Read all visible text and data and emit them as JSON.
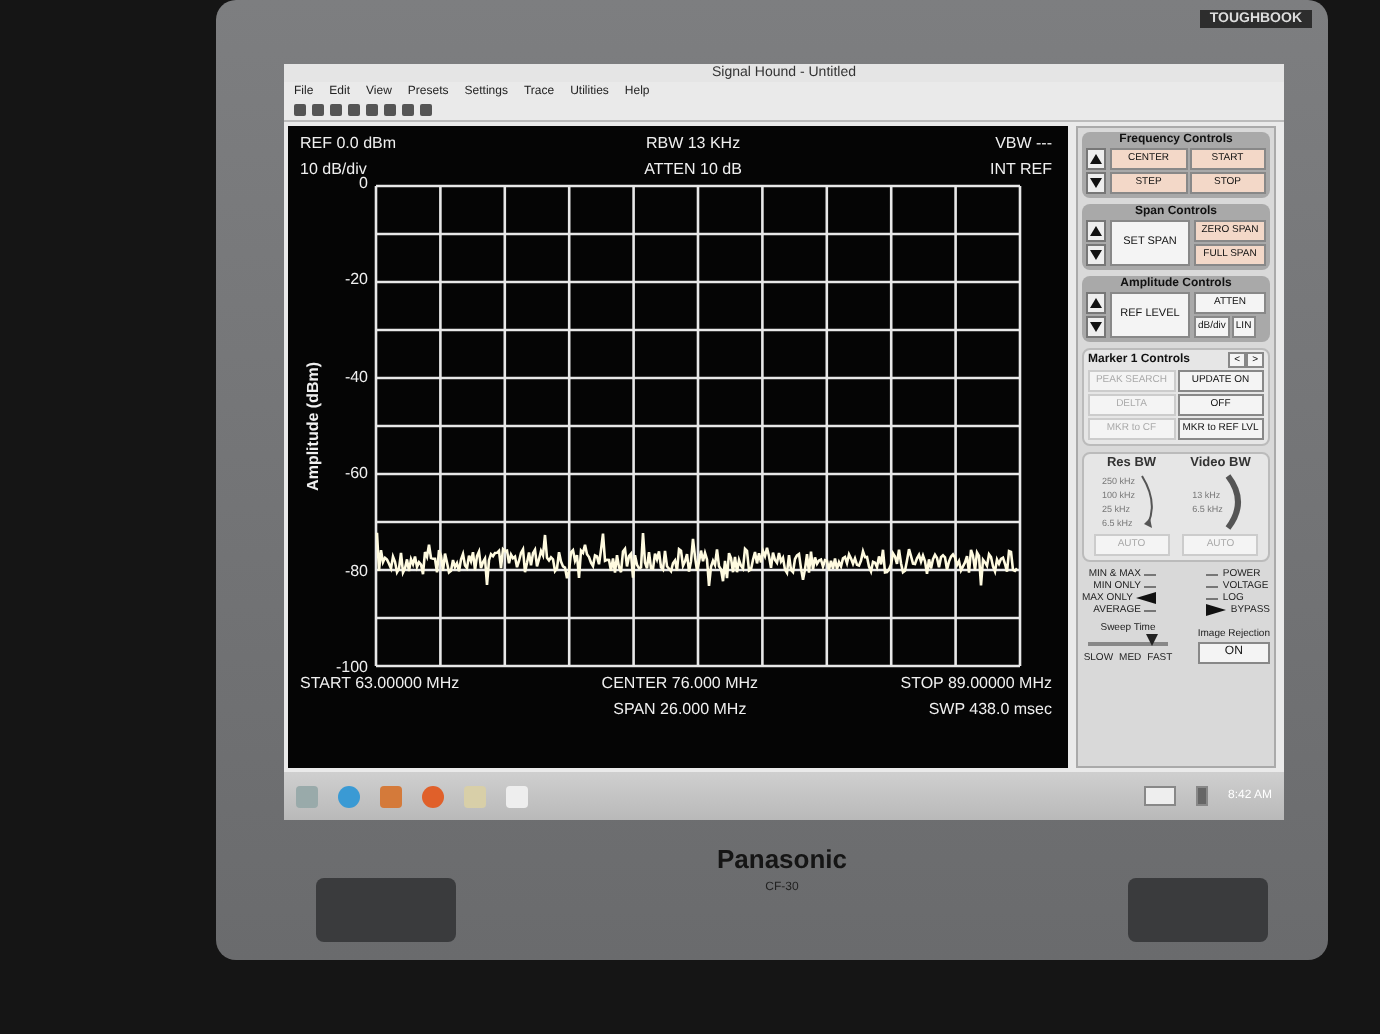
{
  "laptop": {
    "badge": "TOUGHBOOK",
    "brand": "Panasonic",
    "model": "CF-30"
  },
  "window": {
    "title": "Signal Hound - Untitled"
  },
  "menu": [
    "File",
    "Edit",
    "View",
    "Presets",
    "Settings",
    "Trace",
    "Utilities",
    "Help"
  ],
  "display": {
    "ref": "REF 0.0 dBm",
    "scale": "10 dB/div",
    "rbw": "RBW 13 KHz",
    "atten": "ATTEN 10 dB",
    "vbw": "VBW ---",
    "ref_source": "INT REF",
    "y_axis_label": "Amplitude (dBm)",
    "y_ticks": [
      "0",
      "-20",
      "-40",
      "-60",
      "-80",
      "-100"
    ],
    "start": "START 63.00000 MHz",
    "center": "CENTER 76.000 MHz",
    "span": "SPAN 26.000 MHz",
    "stop": "STOP 89.00000 MHz",
    "sweep": "SWP 438.0 msec"
  },
  "frequency": {
    "title": "Frequency Controls",
    "buttons": [
      "CENTER",
      "START",
      "STEP",
      "STOP"
    ]
  },
  "span": {
    "title": "Span Controls",
    "main": "SET SPAN",
    "buttons": [
      "ZERO SPAN",
      "FULL SPAN"
    ]
  },
  "amplitude": {
    "title": "Amplitude Controls",
    "main": "REF LEVEL",
    "buttons": [
      "ATTEN",
      "dB/div",
      "LIN"
    ]
  },
  "marker": {
    "title": "Marker 1 Controls",
    "spin": [
      "<",
      ">"
    ],
    "buttons": [
      {
        "label": "PEAK SEARCH",
        "disabled": true
      },
      {
        "label": "UPDATE ON",
        "disabled": false
      },
      {
        "label": "DELTA",
        "disabled": true
      },
      {
        "label": "OFF",
        "disabled": false
      },
      {
        "label": "MKR to CF",
        "disabled": true
      },
      {
        "label": "MKR to REF LVL",
        "disabled": false
      }
    ]
  },
  "res_bw": {
    "title": "Res BW",
    "labels": [
      "250 kHz",
      "100 kHz",
      "25 kHz",
      "6.5 kHz"
    ],
    "auto": "AUTO"
  },
  "video_bw": {
    "title": "Video BW",
    "labels": [
      "13 kHz",
      "6.5 kHz"
    ],
    "auto": "AUTO"
  },
  "detector": [
    {
      "label": "MIN & MAX",
      "selected": false
    },
    {
      "label": "MIN ONLY",
      "selected": false
    },
    {
      "label": "MAX ONLY",
      "selected": true
    },
    {
      "label": "AVERAGE",
      "selected": false
    }
  ],
  "units": [
    {
      "label": "POWER",
      "selected": false
    },
    {
      "label": "VOLTAGE",
      "selected": false
    },
    {
      "label": "LOG",
      "selected": false
    },
    {
      "label": "BYPASS",
      "selected": true
    }
  ],
  "sweep_time": {
    "title": "Sweep Time",
    "level": 0.8,
    "labels": [
      "SLOW",
      "MED",
      "FAST"
    ]
  },
  "image_rejection": {
    "title": "Image Rejection",
    "button": "ON"
  },
  "taskbar": {
    "time": "8:42 AM"
  }
}
